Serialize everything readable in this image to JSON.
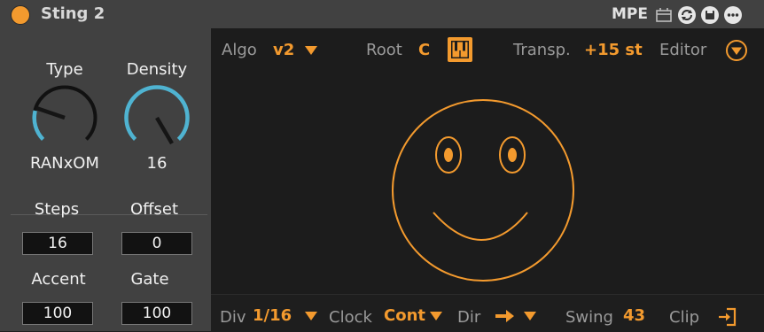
{
  "device": {
    "title": "Sting 2"
  },
  "titlebar": {
    "mpe_label": "MPE"
  },
  "knobs": {
    "type": {
      "label": "Type",
      "value": "RANxOM"
    },
    "density": {
      "label": "Density",
      "value": "16"
    }
  },
  "params": {
    "steps": {
      "label": "Steps",
      "value": "16"
    },
    "offset": {
      "label": "Offset",
      "value": "0"
    },
    "accent": {
      "label": "Accent",
      "value": "100"
    },
    "gate": {
      "label": "Gate",
      "value": "100"
    }
  },
  "topbar": {
    "algo_label": "Algo",
    "algo_value": "v2",
    "root_label": "Root",
    "root_value": "C",
    "transp_label": "Transp.",
    "transp_value": "+15 st",
    "editor_label": "Editor"
  },
  "bottombar": {
    "div_label": "Div",
    "div_value": "1/16",
    "clock_label": "Clock",
    "clock_value": "Cont",
    "dir_label": "Dir",
    "swing_label": "Swing",
    "swing_value": "43",
    "clip_label": "Clip"
  },
  "colors": {
    "accent": "#f39a2e",
    "knob_arc": "#4fb3d1",
    "panel": "#414141",
    "display": "#1c1c1c"
  }
}
